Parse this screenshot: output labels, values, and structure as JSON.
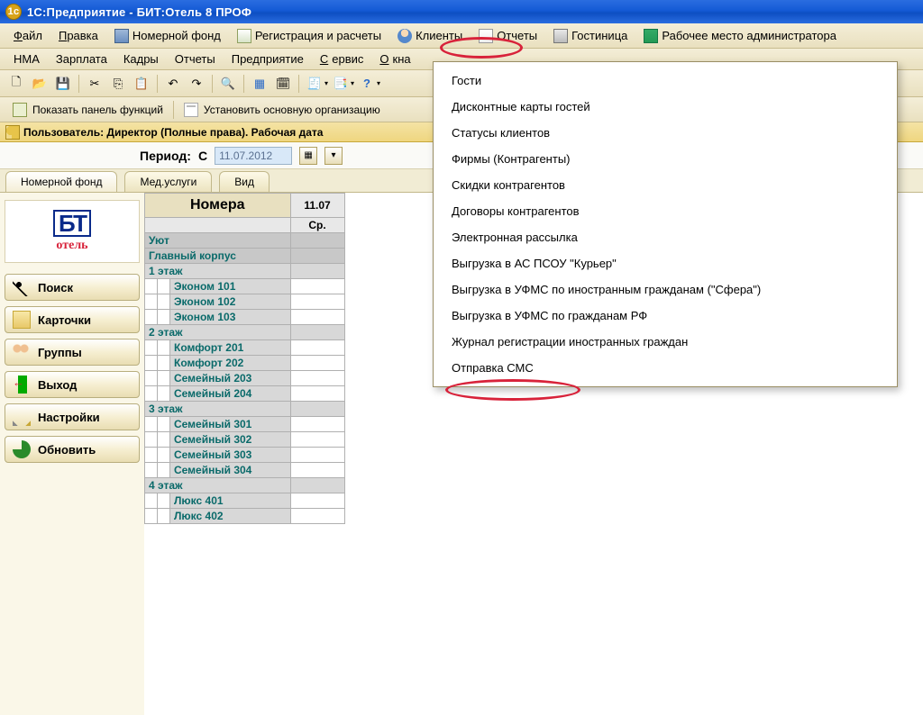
{
  "title": "1С:Предприятие - БИТ:Отель 8 ПРОФ",
  "main_menu": [
    {
      "label": "Файл",
      "u": "Ф"
    },
    {
      "label": "Правка",
      "u": "П"
    },
    {
      "label": "Номерной фонд",
      "icon": "ic-building"
    },
    {
      "label": "Регистрация и расчеты",
      "icon": "ic-doc"
    },
    {
      "label": "Клиенты",
      "icon": "ic-person"
    },
    {
      "label": "Отчеты",
      "icon": "ic-report"
    },
    {
      "label": "Гостиница",
      "icon": "ic-hotel"
    },
    {
      "label": "Рабочее место администратора",
      "icon": "ic-monitor"
    }
  ],
  "menu2": [
    "НМА",
    "Зарплата",
    "Кадры",
    "Отчеты",
    "Предприятие",
    "Сервис",
    "Окна"
  ],
  "menu2_underline": [
    "",
    "",
    "",
    "",
    "",
    "С",
    "О"
  ],
  "dropdown_items": [
    "Гости",
    "Дисконтные карты гостей",
    "Статусы клиентов",
    "Фирмы (Контрагенты)",
    "Скидки контрагентов",
    "Договоры контрагентов",
    "Электронная рассылка",
    "Выгрузка в АС ПСОУ \"Курьер\"",
    "Выгрузка в УФМС по иностранным гражданам (\"Сфера\")",
    "Выгрузка в УФМС по гражданам РФ",
    "Журнал регистрации иностранных граждан",
    "Отправка СМС"
  ],
  "func_bar": {
    "show_panel": "Показать панель функций",
    "set_org": "Установить основную организацию"
  },
  "user_bar": "Пользователь: Директор (Полные права). Рабочая дата",
  "period": {
    "label": "Период:",
    "from_lbl": "С",
    "date": "11.07.2012"
  },
  "tabs": [
    "Номерной фонд",
    "Мед.услуги",
    "Вид"
  ],
  "logo": {
    "top": "БТ",
    "bottom": "отель"
  },
  "side_buttons": [
    {
      "label": "Поиск",
      "ic": "sb-search"
    },
    {
      "label": "Карточки",
      "ic": "sb-cards"
    },
    {
      "label": "Группы",
      "ic": "sb-groups"
    },
    {
      "label": "Выход",
      "ic": "sb-exit"
    },
    {
      "label": "Настройки",
      "ic": "sb-settings"
    },
    {
      "label": "Обновить",
      "ic": "sb-refresh"
    }
  ],
  "grid": {
    "header": "Номера",
    "date": "11.07",
    "weekday": "Ср.",
    "groups": [
      {
        "g": "Уют"
      },
      {
        "g": "Главный корпус"
      },
      {
        "f": "1 этаж",
        "rooms": [
          "Эконом 101",
          "Эконом 102",
          "Эконом 103"
        ]
      },
      {
        "f": "2 этаж",
        "rooms": [
          "Комфорт 201",
          "Комфорт 202",
          "Семейный 203",
          "Семейный 204"
        ]
      },
      {
        "f": "3 этаж",
        "rooms": [
          "Семейный 301",
          "Семейный 302",
          "Семейный 303",
          "Семейный 304"
        ]
      },
      {
        "f": "4 этаж",
        "rooms": [
          "Люкс 401",
          "Люкс 402"
        ]
      }
    ]
  }
}
